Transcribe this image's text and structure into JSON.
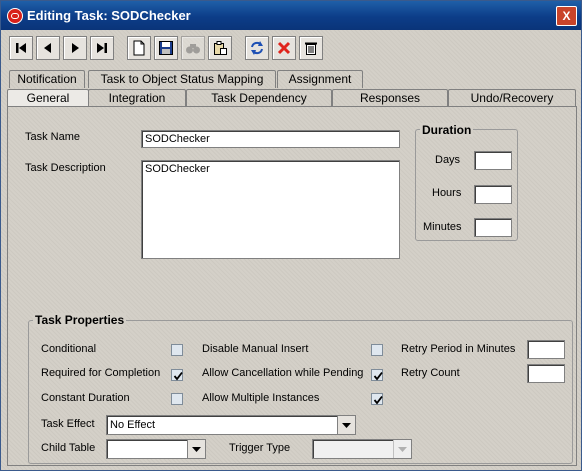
{
  "window": {
    "title": "Editing Task: SODChecker",
    "close_label": "X"
  },
  "toolbar": {
    "buttons": [
      "first-icon",
      "previous-icon",
      "next-icon",
      "last-icon",
      "new-document-icon",
      "save-icon",
      "find-icon",
      "clipboard-icon",
      "refresh-icon",
      "delete-icon",
      "trash-icon"
    ]
  },
  "tabs": {
    "row1": [
      "Notification",
      "Task to Object Status Mapping",
      "Assignment"
    ],
    "row2": [
      "General",
      "Integration",
      "Task Dependency",
      "Responses",
      "Undo/Recovery"
    ],
    "active": "General"
  },
  "general": {
    "task_name_label": "Task Name",
    "task_name_value": "SODChecker",
    "task_description_label": "Task Description",
    "task_description_value": "SODChecker",
    "duration": {
      "title": "Duration",
      "days_label": "Days",
      "hours_label": "Hours",
      "minutes_label": "Minutes",
      "days_value": "",
      "hours_value": "",
      "minutes_value": ""
    }
  },
  "task_properties": {
    "title": "Task Properties",
    "conditional_label": "Conditional",
    "conditional_checked": false,
    "required_label": "Required for Completion",
    "required_checked": true,
    "constant_duration_label": "Constant Duration",
    "constant_duration_checked": false,
    "disable_manual_insert_label": "Disable Manual Insert",
    "disable_manual_insert_checked": false,
    "allow_cancellation_label": "Allow Cancellation while Pending",
    "allow_cancellation_checked": true,
    "allow_multiple_label": "Allow Multiple Instances",
    "allow_multiple_checked": true,
    "retry_period_label": "Retry Period in Minutes",
    "retry_period_value": "",
    "retry_count_label": "Retry Count",
    "retry_count_value": "",
    "task_effect_label": "Task Effect",
    "task_effect_value": "No Effect",
    "child_table_label": "Child Table",
    "child_table_value": "",
    "trigger_type_label": "Trigger Type",
    "trigger_type_value": ""
  }
}
